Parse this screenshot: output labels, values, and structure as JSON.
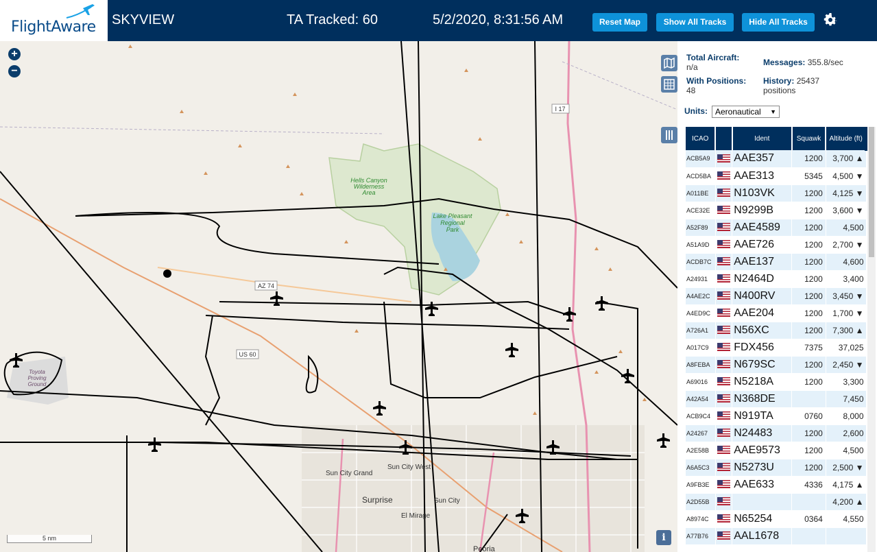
{
  "header": {
    "brand": "FlightAware",
    "app_title": "SKYVIEW",
    "tracked": "TA Tracked: 60",
    "clock": "5/2/2020, 8:31:56 AM",
    "buttons": {
      "reset": "Reset Map",
      "show": "Show All Tracks",
      "hide": "Hide All Tracks"
    },
    "settings_icon": "gear-icon"
  },
  "map": {
    "zoom_in": "+",
    "zoom_out": "−",
    "scale": "5 nm",
    "info": "i",
    "labels": {
      "hells_canyon": [
        "Hells Canyon",
        "Wilderness",
        "Area"
      ],
      "lake_pleasant": [
        "Lake Pleasant",
        "Regional",
        "Park"
      ],
      "toyota": [
        "Toyota",
        "Proving",
        "Ground"
      ],
      "az74": "AZ 74",
      "us60": "US 60",
      "i17": "I 17",
      "sun_city_grand": "Sun City Grand",
      "sun_city_west": "Sun City West",
      "surprise": "Surprise",
      "el_mirage": "El Mirage",
      "sun_city": "Sun City",
      "peoria": "Peoria"
    }
  },
  "sidebar": {
    "total_label": "Total Aircraft:",
    "total_value": "n/a",
    "positions_label": "With Positions:",
    "positions_value": "48",
    "messages_label": "Messages:",
    "messages_value": "355.8/sec",
    "history_label": "History:",
    "history_value": "25437",
    "history_unit": "positions",
    "units_label": "Units:",
    "units_value": "Aeronautical",
    "columns": [
      "ICAO",
      "",
      "Ident",
      "Squawk",
      "Altitude (ft)"
    ],
    "rows": [
      {
        "icao": "ACB5A9",
        "ident": "AAE357",
        "squawk": "1200",
        "alt": "3,700 ▲"
      },
      {
        "icao": "ACD5BA",
        "ident": "AAE313",
        "squawk": "5345",
        "alt": "4,500 ▼"
      },
      {
        "icao": "A011BE",
        "ident": "N103VK",
        "squawk": "1200",
        "alt": "4,125 ▼"
      },
      {
        "icao": "ACE32E",
        "ident": "N9299B",
        "squawk": "1200",
        "alt": "3,600 ▼"
      },
      {
        "icao": "A52F89",
        "ident": "AAE4589",
        "squawk": "1200",
        "alt": "4,500"
      },
      {
        "icao": "A51A9D",
        "ident": "AAE726",
        "squawk": "1200",
        "alt": "2,700 ▼"
      },
      {
        "icao": "ACDB7C",
        "ident": "AAE137",
        "squawk": "1200",
        "alt": "4,600"
      },
      {
        "icao": "A24931",
        "ident": "N2464D",
        "squawk": "1200",
        "alt": "3,400"
      },
      {
        "icao": "A4AE2C",
        "ident": "N400RV",
        "squawk": "1200",
        "alt": "3,450 ▼"
      },
      {
        "icao": "A4ED9C",
        "ident": "AAE204",
        "squawk": "1200",
        "alt": "1,700 ▼"
      },
      {
        "icao": "A726A1",
        "ident": "N56XC",
        "squawk": "1200",
        "alt": "7,300 ▲"
      },
      {
        "icao": "A017C9",
        "ident": "FDX456",
        "squawk": "7375",
        "alt": "37,025"
      },
      {
        "icao": "A8FEBA",
        "ident": "N679SC",
        "squawk": "1200",
        "alt": "2,450 ▼"
      },
      {
        "icao": "A69016",
        "ident": "N5218A",
        "squawk": "1200",
        "alt": "3,300"
      },
      {
        "icao": "A42A54",
        "ident": "N368DE",
        "squawk": "",
        "alt": "7,450"
      },
      {
        "icao": "ACB9C4",
        "ident": "N919TA",
        "squawk": "0760",
        "alt": "8,000"
      },
      {
        "icao": "A24267",
        "ident": "N24483",
        "squawk": "1200",
        "alt": "2,600"
      },
      {
        "icao": "A2E58B",
        "ident": "AAE9573",
        "squawk": "1200",
        "alt": "4,500"
      },
      {
        "icao": "A6A5C3",
        "ident": "N5273U",
        "squawk": "1200",
        "alt": "2,500 ▼"
      },
      {
        "icao": "A9FB3E",
        "ident": "AAE633",
        "squawk": "4336",
        "alt": "4,175 ▲"
      },
      {
        "icao": "A2D55B",
        "ident": "",
        "squawk": "",
        "alt": "4,200 ▲"
      },
      {
        "icao": "A8974C",
        "ident": "N65254",
        "squawk": "0364",
        "alt": "4,550"
      },
      {
        "icao": "A77B76",
        "ident": "AAL1678",
        "squawk": "",
        "alt": ""
      }
    ]
  },
  "colors": {
    "header_bg": "#002f5d",
    "button": "#0e92d9",
    "row_alt": "#e4f1fa"
  }
}
